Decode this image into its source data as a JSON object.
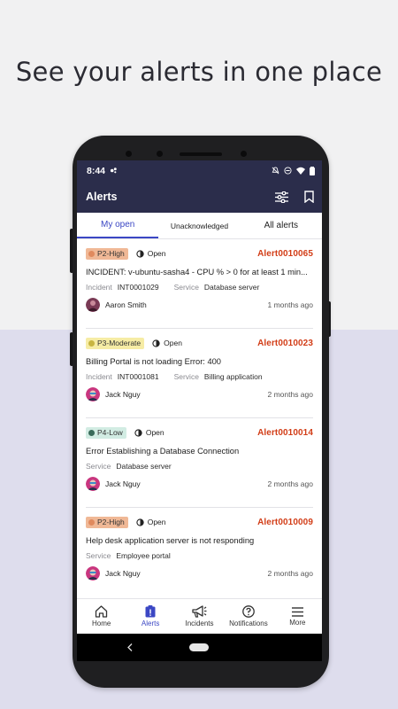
{
  "headline": "See your alerts in one place",
  "status_bar": {
    "time": "8:44"
  },
  "app": {
    "title": "Alerts"
  },
  "tabs": [
    {
      "label": "My open",
      "active": true
    },
    {
      "label": "Unacknowledged",
      "active": false
    },
    {
      "label": "All alerts",
      "active": false
    }
  ],
  "alerts": [
    {
      "priority": "P2-High",
      "priority_color": "#f0b896",
      "priority_dot": "#e08a5e",
      "state": "Open",
      "number": "Alert0010065",
      "summary": "INCIDENT: v-ubuntu-sasha4 - CPU % > 0 for at least 1 min...",
      "incident_label": "Incident",
      "incident": "INT0001029",
      "service_label": "Service",
      "service": "Database server",
      "user": "Aaron  Smith",
      "ago": "1 months ago"
    },
    {
      "priority": "P3-Moderate",
      "priority_color": "#f6eca5",
      "priority_dot": "#c8b541",
      "state": "Open",
      "number": "Alert0010023",
      "summary": "Billing Portal is not loading Error: 400",
      "incident_label": "Incident",
      "incident": "INT0001081",
      "service_label": "Service",
      "service": "Billing application",
      "user": "Jack Nguy",
      "ago": "2 months ago"
    },
    {
      "priority": "P4-Low",
      "priority_color": "#d2ece3",
      "priority_dot": "#3a6b5a",
      "state": "Open",
      "number": "Alert0010014",
      "summary": "Error Establishing a Database Connection",
      "service_label": "Service",
      "service": "Database server",
      "user": "Jack Nguy",
      "ago": "2 months ago"
    },
    {
      "priority": "P2-High",
      "priority_color": "#f0b896",
      "priority_dot": "#e08a5e",
      "state": "Open",
      "number": "Alert0010009",
      "summary": "Help desk application server is not responding",
      "service_label": "Service",
      "service": "Employee portal",
      "user": "Jack Nguy",
      "ago": "2 months ago"
    }
  ],
  "bottom_nav": [
    {
      "label": "Home",
      "icon": "home-icon",
      "active": false
    },
    {
      "label": "Alerts",
      "icon": "alert-icon",
      "active": true
    },
    {
      "label": "Incidents",
      "icon": "megaphone-icon",
      "active": false
    },
    {
      "label": "Notifications",
      "icon": "question-icon",
      "active": false
    },
    {
      "label": "More",
      "icon": "menu-icon",
      "active": false
    }
  ],
  "colors": {
    "appbar": "#2b2d4b",
    "accent": "#3b47c4",
    "alert_number": "#d23d17"
  }
}
